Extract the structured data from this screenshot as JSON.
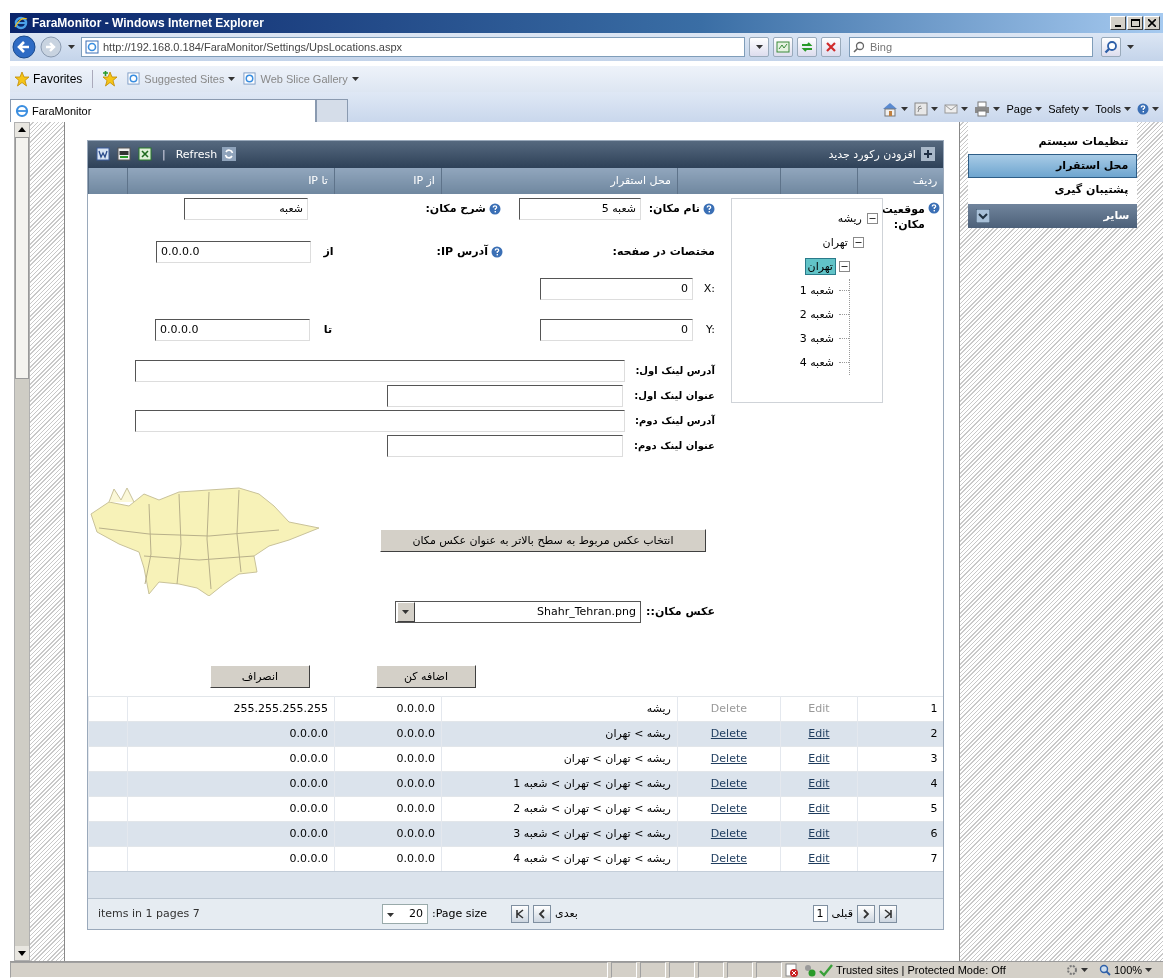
{
  "window": {
    "title": "FaraMonitor - Windows Internet Explorer"
  },
  "address_bar": {
    "url": "http://192.168.0.184/FaraMonitor/Settings/UpsLocations.aspx"
  },
  "search": {
    "placeholder": "Bing"
  },
  "favorites_bar": {
    "label": "Favorites",
    "suggested_sites": "Suggested Sites",
    "web_slice_gallery": "Web Slice Gallery"
  },
  "tabs": [
    {
      "label": "FaraMonitor",
      "selected": true
    }
  ],
  "command_bar": {
    "icons": [
      {
        "kind": "home"
      },
      {
        "kind": "feeds"
      },
      {
        "kind": "mail"
      },
      {
        "kind": "print"
      }
    ],
    "page_menu": "Page",
    "safety_menu": "Safety",
    "tools_menu": "Tools"
  },
  "grid": {
    "toolbar": {
      "separator": "|",
      "refresh": "Refresh",
      "add": "افزودن رکورد جدید"
    },
    "header": {
      "row_number": "ردیف",
      "location": "محل استقرار",
      "ip_from": "از IP",
      "ip_to": "تا IP"
    },
    "form": {
      "location_label": "موقعیت مکان:",
      "tree": [
        {
          "label": "ریشه",
          "expanded": true,
          "selected": false,
          "children": [
            {
              "label": "تهران",
              "expanded": true,
              "selected": false,
              "children": [
                {
                  "label": "تهران",
                  "expanded": true,
                  "selected": true,
                  "children": [
                    {
                      "label": "شعبه 1",
                      "selected": false
                    },
                    {
                      "label": "شعبه 2",
                      "selected": false
                    },
                    {
                      "label": "شعبه 3",
                      "selected": false
                    },
                    {
                      "label": "شعبه 4",
                      "selected": false
                    }
                  ]
                }
              ]
            }
          ]
        }
      ],
      "name": {
        "label": "نام مکان:",
        "value": "شعبه 5"
      },
      "description": {
        "label": "شرح مکان:",
        "value": "شعبه"
      },
      "coordinates_label": "مختصات در صفحه:",
      "x": {
        "label": "X:",
        "value": "0"
      },
      "y": {
        "label": "Y:",
        "value": "0"
      },
      "ip": {
        "label": "آدرس IP:",
        "from_label": "از",
        "from": "0.0.0.0",
        "to_label": "تا",
        "to": "0.0.0.0"
      },
      "links": [
        {
          "label": "آدرس لینک اول:",
          "kind": "address"
        },
        {
          "label": "عنوان لینک اول:",
          "kind": "title"
        },
        {
          "label": "آدرس لینک دوم:",
          "kind": "address"
        },
        {
          "label": "عنوان لینک دوم:",
          "kind": "title"
        }
      ],
      "image_button": "انتخاب عکس مربوط به سطح بالاتر به عنوان عکس مکان",
      "image": {
        "label": "عکس مکان::",
        "value": "Shahr_Tehran.png"
      },
      "buttons": [
        "اضافه کن",
        "انصراف"
      ]
    },
    "rows": [
      {
        "number": "1",
        "edit": "Edit",
        "delete": "Delete",
        "disabled": true,
        "location": "ریشه",
        "ip_from": "0.0.0.0",
        "ip_to": "255.255.255.255"
      },
      {
        "number": "2",
        "edit": "Edit",
        "delete": "Delete",
        "disabled": false,
        "location": "ریشه > تهران",
        "ip_from": "0.0.0.0",
        "ip_to": "0.0.0.0"
      },
      {
        "number": "3",
        "edit": "Edit",
        "delete": "Delete",
        "disabled": false,
        "location": "ریشه > تهران > تهران",
        "ip_from": "0.0.0.0",
        "ip_to": "0.0.0.0"
      },
      {
        "number": "4",
        "edit": "Edit",
        "delete": "Delete",
        "disabled": false,
        "location": "ریشه > تهران > تهران > شعبه 1",
        "ip_from": "0.0.0.0",
        "ip_to": "0.0.0.0"
      },
      {
        "number": "5",
        "edit": "Edit",
        "delete": "Delete",
        "disabled": false,
        "location": "ریشه > تهران > تهران > شعبه 2",
        "ip_from": "0.0.0.0",
        "ip_to": "0.0.0.0"
      },
      {
        "number": "6",
        "edit": "Edit",
        "delete": "Delete",
        "disabled": false,
        "location": "ریشه > تهران > تهران > شعبه 3",
        "ip_from": "0.0.0.0",
        "ip_to": "0.0.0.0"
      },
      {
        "number": "7",
        "edit": "Edit",
        "delete": "Delete",
        "disabled": false,
        "location": "ریشه > تهران > تهران > شعبه 4",
        "ip_from": "0.0.0.0",
        "ip_to": "0.0.0.0"
      }
    ],
    "pager": {
      "summary": "items in 1 pages 7",
      "page_size": "20",
      "page_size_label": ":Page size",
      "next": "بعدی",
      "page": "1",
      "previous": "قبلی"
    }
  },
  "sidebar": {
    "items": [
      {
        "label": "تنظیمات سیستم",
        "selected": false
      },
      {
        "label": "محل استقرار",
        "selected": true
      },
      {
        "label": "پشتیبان گیری",
        "selected": false
      }
    ],
    "group": "سایر"
  },
  "status_bar": {
    "zone": "Trusted sites | Protected Mode: Off",
    "zoom": "100%"
  }
}
